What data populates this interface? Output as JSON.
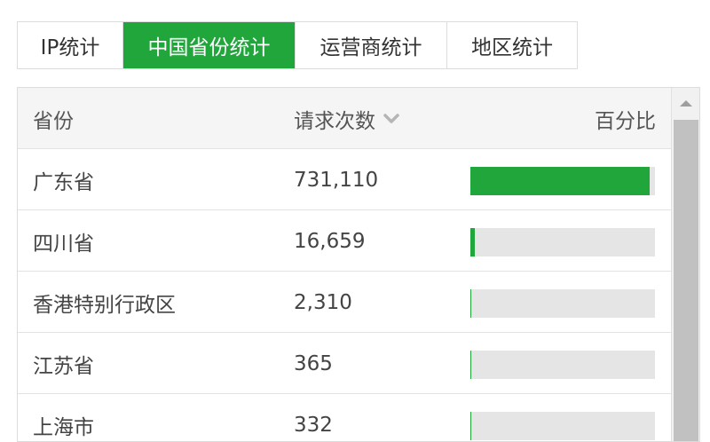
{
  "tabs": [
    {
      "label": "IP统计",
      "active": false
    },
    {
      "label": "中国省份统计",
      "active": true
    },
    {
      "label": "运营商统计",
      "active": false
    },
    {
      "label": "地区统计",
      "active": false
    }
  ],
  "table": {
    "headers": {
      "province": "省份",
      "requests": "请求次数",
      "percent": "百分比"
    },
    "sort_icon": "chevron-down-icon",
    "rows": [
      {
        "province": "广东省",
        "requests": "731,110",
        "share": 0.97
      },
      {
        "province": "四川省",
        "requests": "16,659",
        "share": 0.022
      },
      {
        "province": "香港特别行政区",
        "requests": "2,310",
        "share": 0.003
      },
      {
        "province": "江苏省",
        "requests": "365",
        "share": 0.0005
      },
      {
        "province": "上海市",
        "requests": "332",
        "share": 0.0004
      }
    ]
  },
  "colors": {
    "accent": "#21a63c",
    "track": "#e5e5e5",
    "header_bg": "#f5f5f5"
  }
}
